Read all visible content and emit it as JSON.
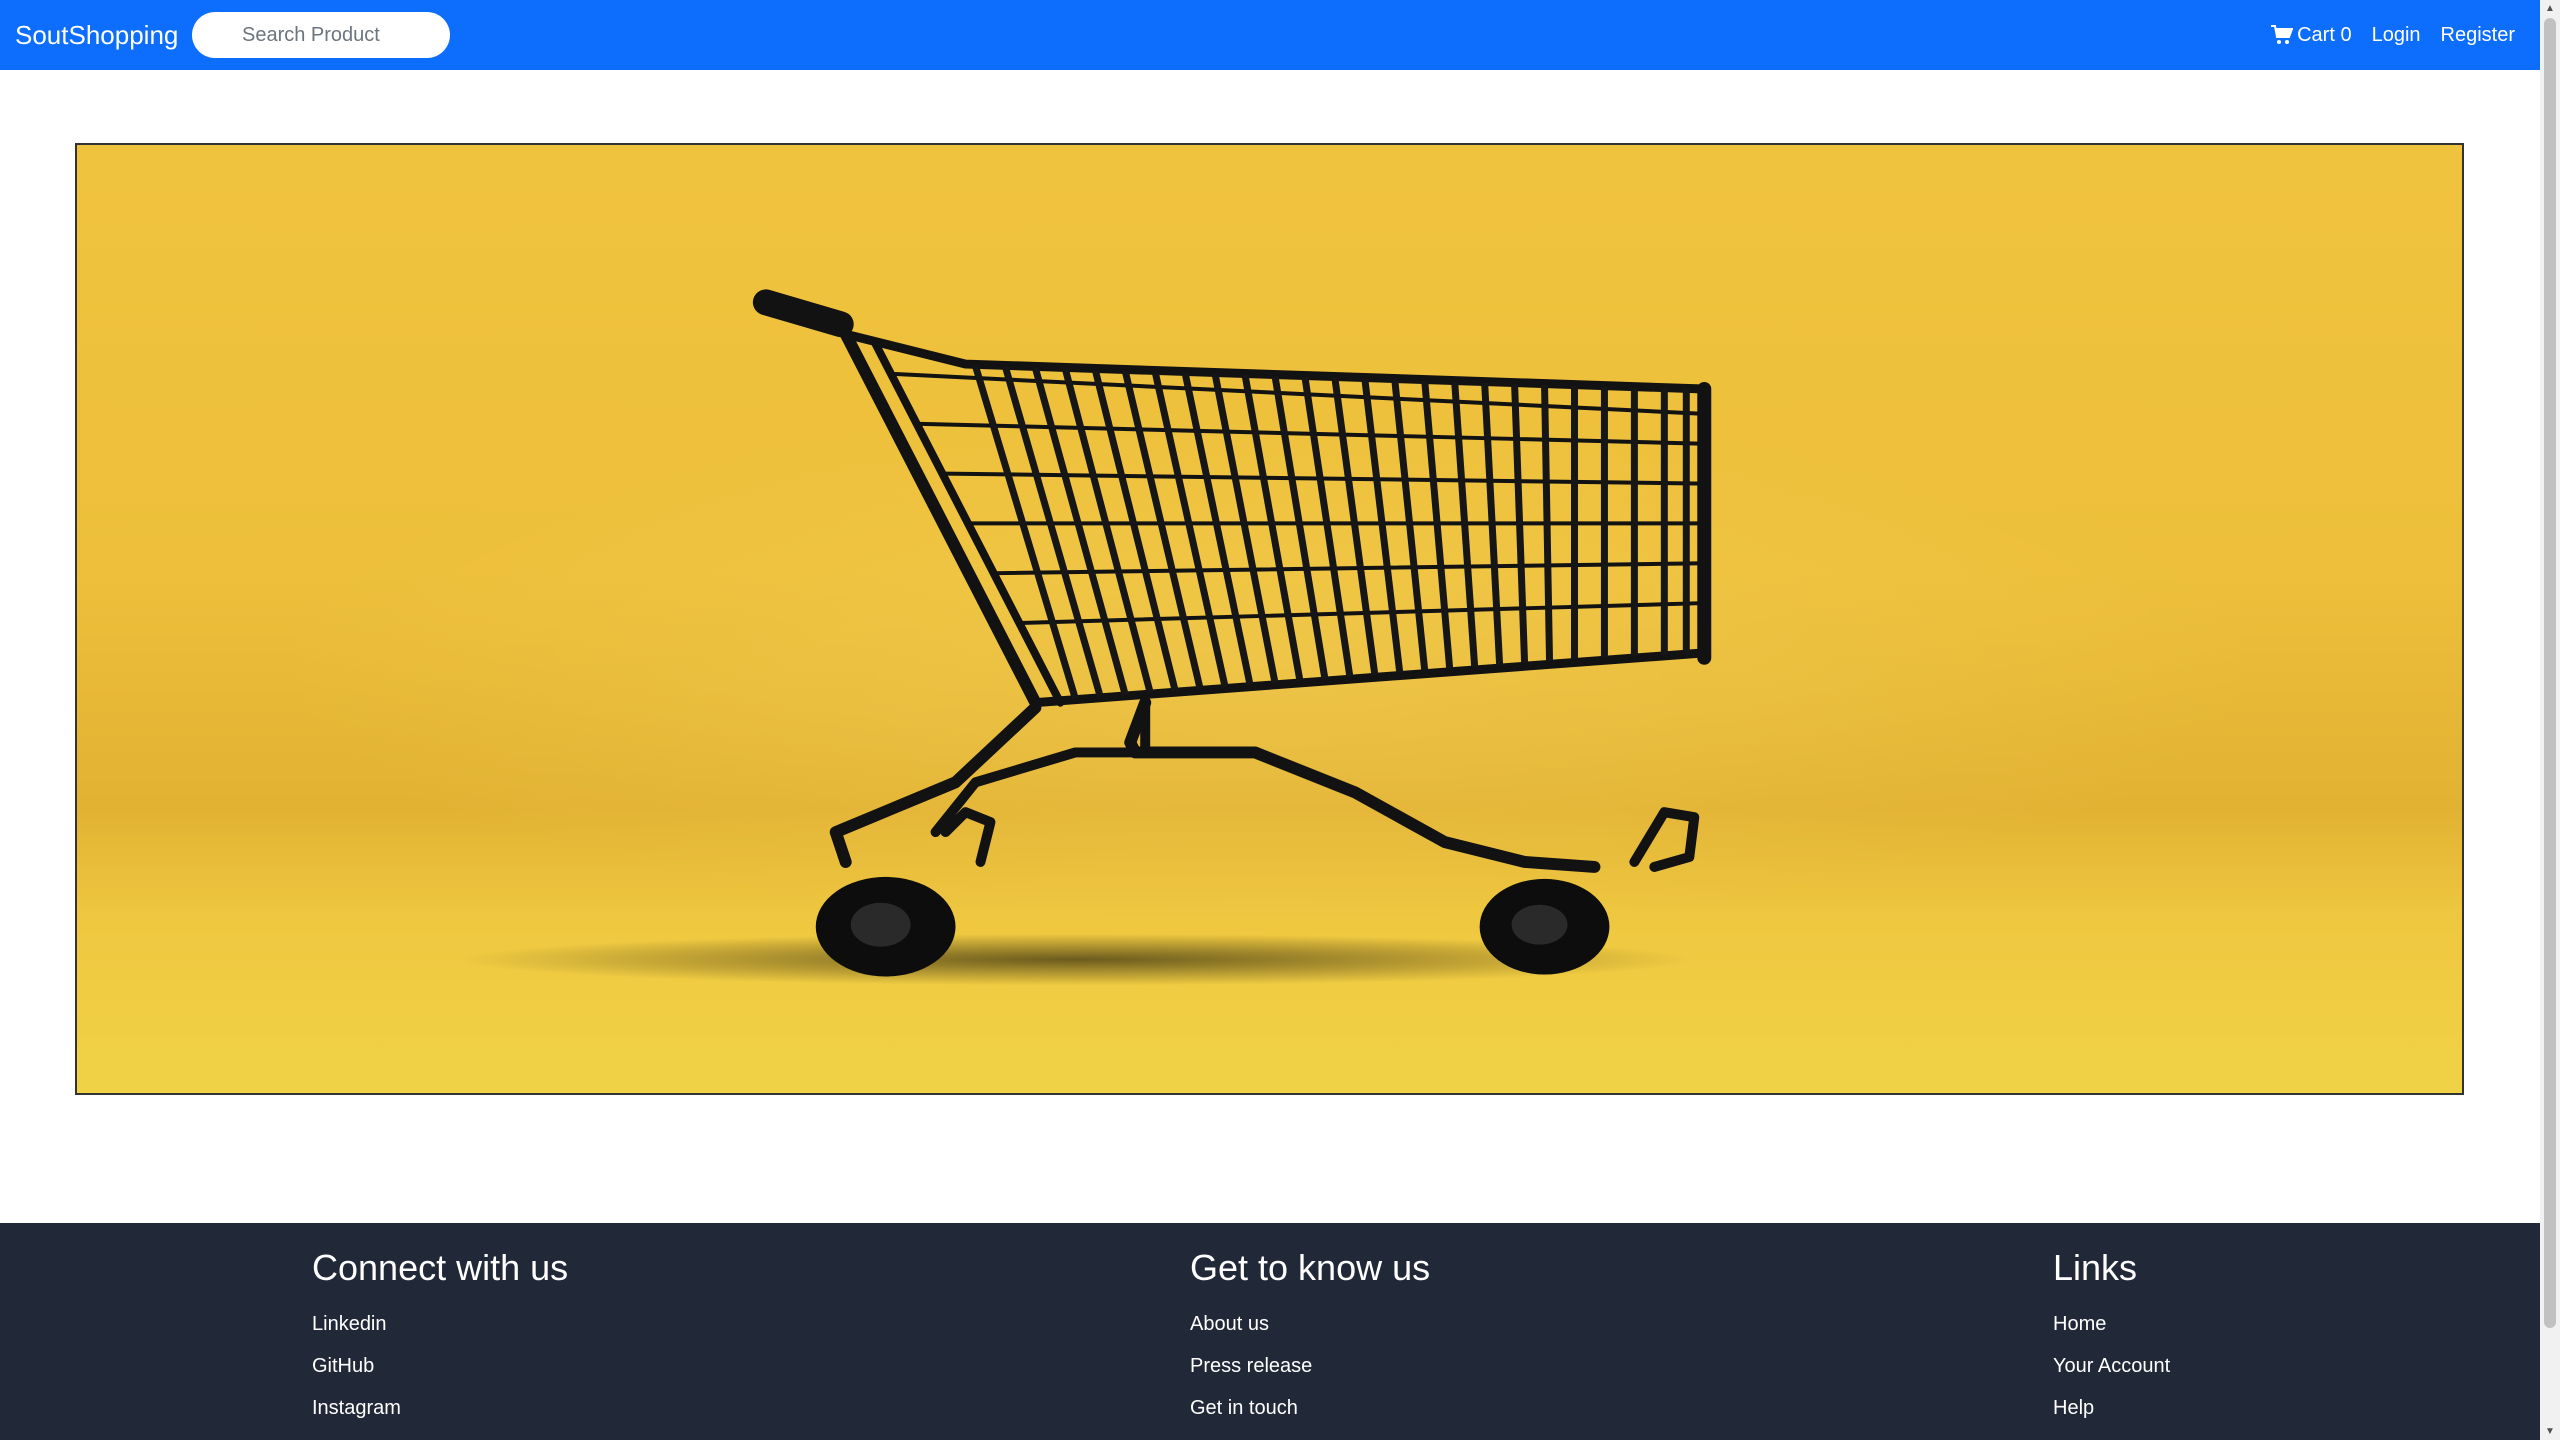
{
  "navbar": {
    "brand": "SoutShopping",
    "search_placeholder": "Search Product",
    "cart_label": "Cart 0",
    "login_label": "Login",
    "register_label": "Register",
    "accent_color": "#0d6efd"
  },
  "hero": {
    "image": "shopping-cart-on-yellow-background",
    "background_color": "#f0c33e"
  },
  "footer": {
    "background_color": "#212837",
    "columns": [
      {
        "title": "Connect with us",
        "links": [
          "Linkedin",
          "GitHub",
          "Instagram"
        ]
      },
      {
        "title": "Get to know us",
        "links": [
          "About us",
          "Press release",
          "Get in touch"
        ]
      },
      {
        "title": "Links",
        "links": [
          "Home",
          "Your Account",
          "Help"
        ]
      }
    ]
  }
}
